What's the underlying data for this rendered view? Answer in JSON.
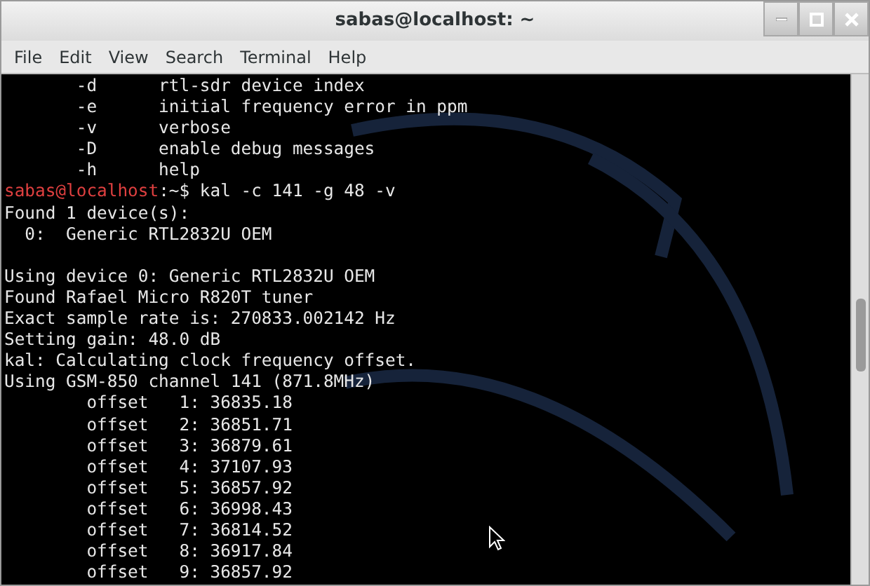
{
  "window": {
    "title": "sabas@localhost: ~"
  },
  "menu": [
    "File",
    "Edit",
    "View",
    "Search",
    "Terminal",
    "Help"
  ],
  "terminal": {
    "lines": [
      {
        "kind": "output",
        "text": "       -d      rtl-sdr device index"
      },
      {
        "kind": "output",
        "text": "       -e      initial frequency error in ppm"
      },
      {
        "kind": "output",
        "text": "       -v      verbose"
      },
      {
        "kind": "output",
        "text": "       -D      enable debug messages"
      },
      {
        "kind": "output",
        "text": "       -h      help"
      },
      {
        "kind": "prompt",
        "prompt": "sabas@localhost",
        "text": ":~$ kal -c 141 -g 48 -v"
      },
      {
        "kind": "output",
        "text": "Found 1 device(s):"
      },
      {
        "kind": "output",
        "text": "  0:  Generic RTL2832U OEM"
      },
      {
        "kind": "blank"
      },
      {
        "kind": "output",
        "text": "Using device 0: Generic RTL2832U OEM"
      },
      {
        "kind": "output",
        "text": "Found Rafael Micro R820T tuner"
      },
      {
        "kind": "output",
        "text": "Exact sample rate is: 270833.002142 Hz"
      },
      {
        "kind": "output",
        "text": "Setting gain: 48.0 dB"
      },
      {
        "kind": "output",
        "text": "kal: Calculating clock frequency offset."
      },
      {
        "kind": "output",
        "text": "Using GSM-850 channel 141 (871.8MHz)"
      },
      {
        "kind": "output",
        "text": "        offset   1: 36835.18"
      },
      {
        "kind": "output",
        "text": "        offset   2: 36851.71"
      },
      {
        "kind": "output",
        "text": "        offset   3: 36879.61"
      },
      {
        "kind": "output",
        "text": "        offset   4: 37107.93"
      },
      {
        "kind": "output",
        "text": "        offset   5: 36857.92"
      },
      {
        "kind": "output",
        "text": "        offset   6: 36998.43"
      },
      {
        "kind": "output",
        "text": "        offset   7: 36814.52"
      },
      {
        "kind": "output",
        "text": "        offset   8: 36917.84"
      },
      {
        "kind": "output",
        "text": "        offset   9: 36857.92"
      }
    ]
  }
}
